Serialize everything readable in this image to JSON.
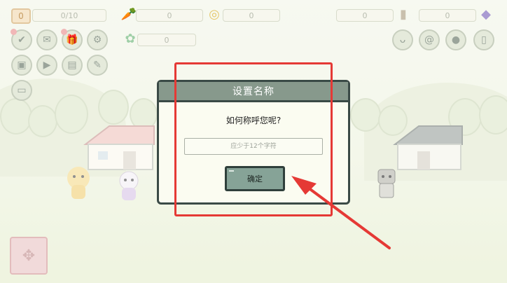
{
  "hud": {
    "level": "0",
    "xp": "0/10",
    "carrot": "0",
    "coin": "0",
    "wood": "0",
    "gem": "0",
    "clover": "0"
  },
  "dialog": {
    "title": "设置名称",
    "question": "如何称呼您呢?",
    "input_placeholder": "应少于12个字符",
    "input_value": "",
    "confirm_label": "确定"
  },
  "icons": {
    "carrot": "carrot-icon",
    "coin": "coin-icon",
    "clover": "clover-icon",
    "wood": "wood-log-icon",
    "gem": "gem-icon",
    "check": "check-icon",
    "mail": "mail-icon",
    "gift": "gift-icon",
    "settings": "gear-icon",
    "chest": "chest-icon",
    "play": "play-icon",
    "news": "news-icon",
    "brush": "brush-icon",
    "ticket": "ticket-icon",
    "bunny": "bunny-icon",
    "snail": "snail-icon",
    "pet": "pet-icon",
    "book": "book-icon",
    "map": "map-icon"
  },
  "colors": {
    "dialog_header": "#87998c",
    "dialog_border": "#3a4a46",
    "confirm_button": "#86a397",
    "annotation": "#e53935"
  }
}
